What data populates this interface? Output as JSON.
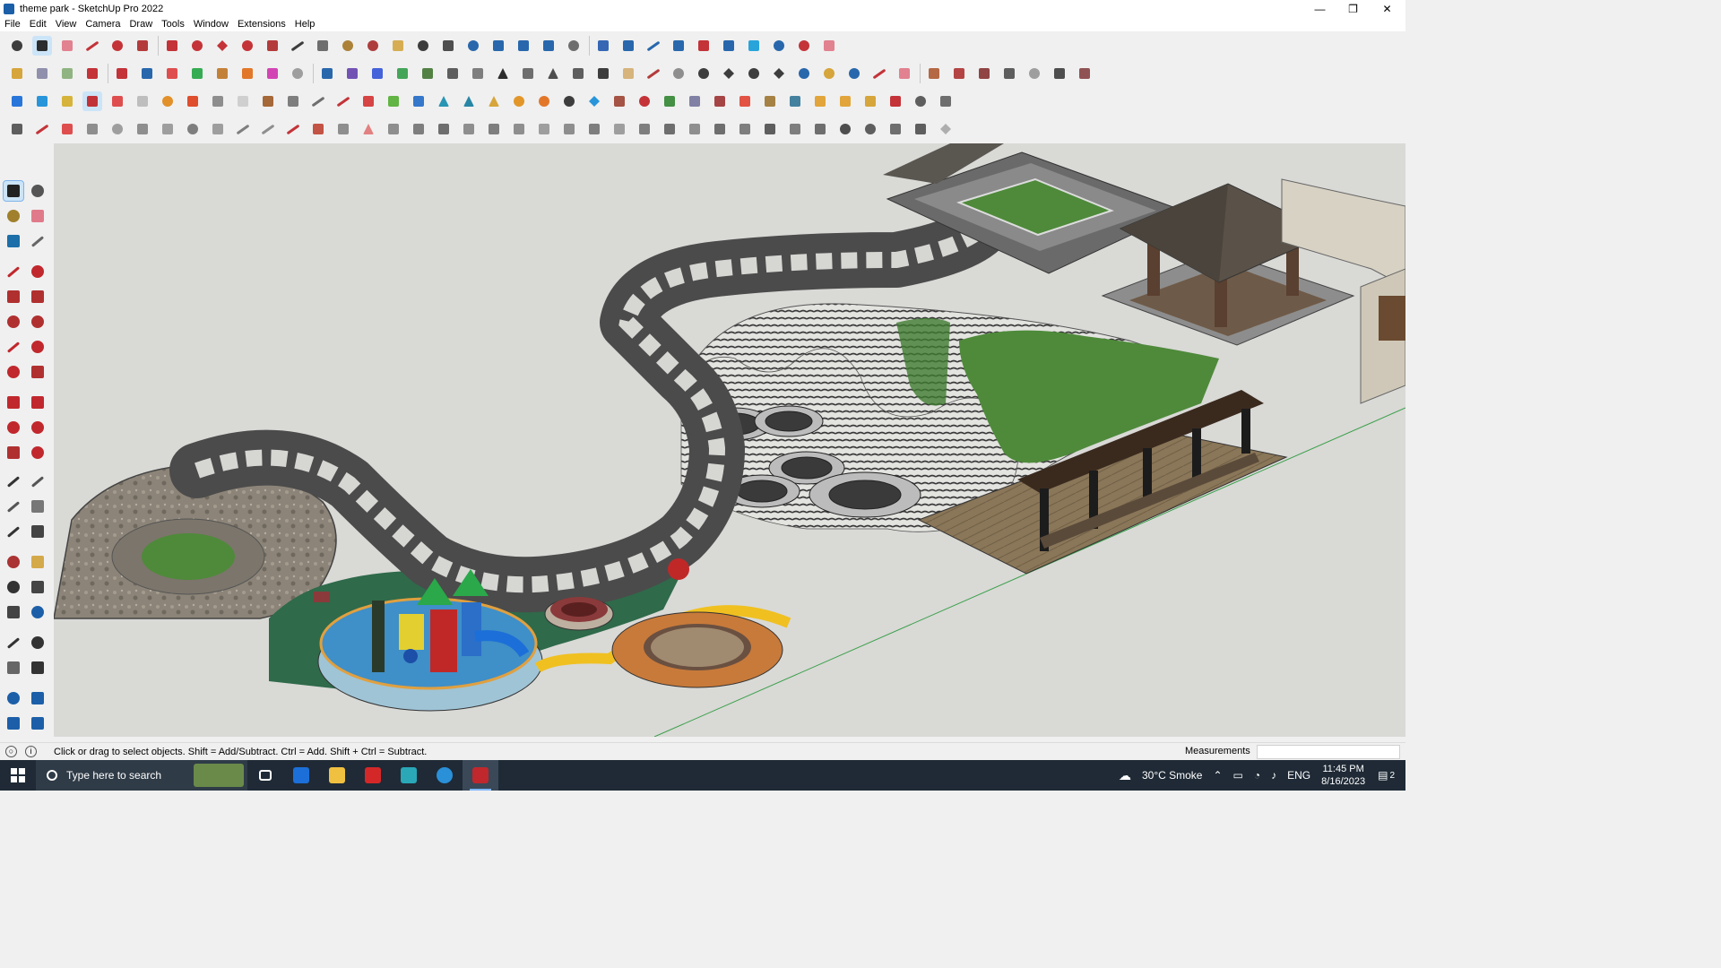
{
  "window": {
    "title": "theme park - SketchUp Pro 2022",
    "controls": [
      "—",
      "❐",
      "✕"
    ]
  },
  "menu": [
    "File",
    "Edit",
    "View",
    "Camera",
    "Draw",
    "Tools",
    "Window",
    "Extensions",
    "Help"
  ],
  "status": {
    "hint": "Click or drag to select objects. Shift = Add/Subtract. Ctrl = Add. Shift + Ctrl = Subtract.",
    "measurements_label": "Measurements",
    "measurements_value": ""
  },
  "taskbar": {
    "search_placeholder": "Type here to search",
    "weather": "30°C  Smoke",
    "language": "ENG",
    "time": "11:45 PM",
    "date": "8/16/2023",
    "notification_count": "2"
  },
  "colors": {
    "viewport_bg": "#d9d9d6",
    "grass": "#4e8a3a",
    "path": "#5e5e5e",
    "deck": "#8a7658"
  }
}
